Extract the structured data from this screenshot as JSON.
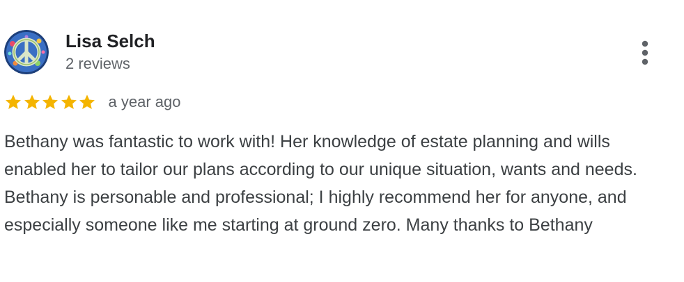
{
  "review": {
    "reviewer_name": "Lisa Selch",
    "review_count": "2 reviews",
    "avatar_icon": "peace-sign-icon",
    "more_icon": "more-vertical-icon",
    "rating": 5,
    "rating_max": 5,
    "date": "a year ago",
    "text": "Bethany was fantastic to work with! Her knowledge of estate planning and wills enabled her to tailor our plans according to our unique situation, wants and needs. Bethany is personable and professional; I highly recommend her for anyone, and especially someone like me starting at ground zero. Many thanks to Bethany"
  },
  "colors": {
    "star": "#f4b400",
    "name": "#202124",
    "secondary_text": "#5f6368",
    "body_text": "#3c4043",
    "menu_dots": "#5f6368"
  }
}
